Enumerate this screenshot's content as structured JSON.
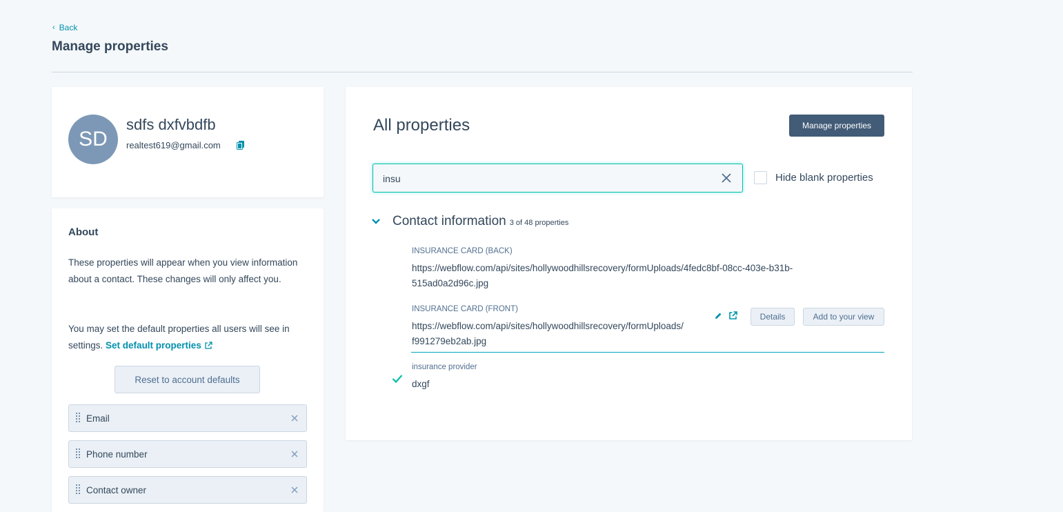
{
  "header": {
    "back_label": "Back",
    "title": "Manage properties"
  },
  "profile": {
    "initials": "SD",
    "name": "sdfs dxfvbdfb",
    "email": "realtest619@gmail.com"
  },
  "about": {
    "title": "About",
    "paragraph1": "These properties will appear when you view information about a contact. These changes will only affect you.",
    "paragraph2_prefix": "You may set the default properties all users will see in settings.",
    "set_default_link": "Set default properties",
    "reset_button": "Reset to account defaults",
    "selected_properties": [
      {
        "label": "Email"
      },
      {
        "label": "Phone number"
      },
      {
        "label": "Contact owner"
      }
    ]
  },
  "all_properties": {
    "title": "All properties",
    "manage_button": "Manage properties",
    "search_value": "insu",
    "hide_blank_label": "Hide blank properties",
    "hide_blank_checked": false,
    "section": {
      "title": "Contact information",
      "count": "3 of 48 properties",
      "expanded": true
    },
    "properties": [
      {
        "label": "INSURANCE CARD (BACK)",
        "value_line1": "https://webflow.com/api/sites/hollywoodhillsrecovery/formUploads/4fedc8bf-08cc-403e-b31b-",
        "value_line2": "515ad0a2d96c.jpg"
      },
      {
        "label": "INSURANCE CARD (FRONT)",
        "value_line1": "https://webflow.com/api/sites/hollywoodhillsrecovery/formUploads/",
        "value_line2": "f991279eb2ab.jpg",
        "details_button": "Details",
        "add_to_view_button": "Add to your view",
        "hovered": true
      },
      {
        "label": "insurance provider",
        "value": "dxgf",
        "in_view": true
      }
    ]
  },
  "colors": {
    "accent": "#0091ae",
    "dark_button": "#425b76",
    "text": "#33475b",
    "focus": "#00bda5",
    "check": "#00bda5"
  },
  "icons": [
    "chevron-left-icon",
    "copy-icon",
    "external-link-icon",
    "drag-handle-icon",
    "close-icon",
    "chevron-down-icon",
    "pencil-icon",
    "checkmark-icon"
  ]
}
